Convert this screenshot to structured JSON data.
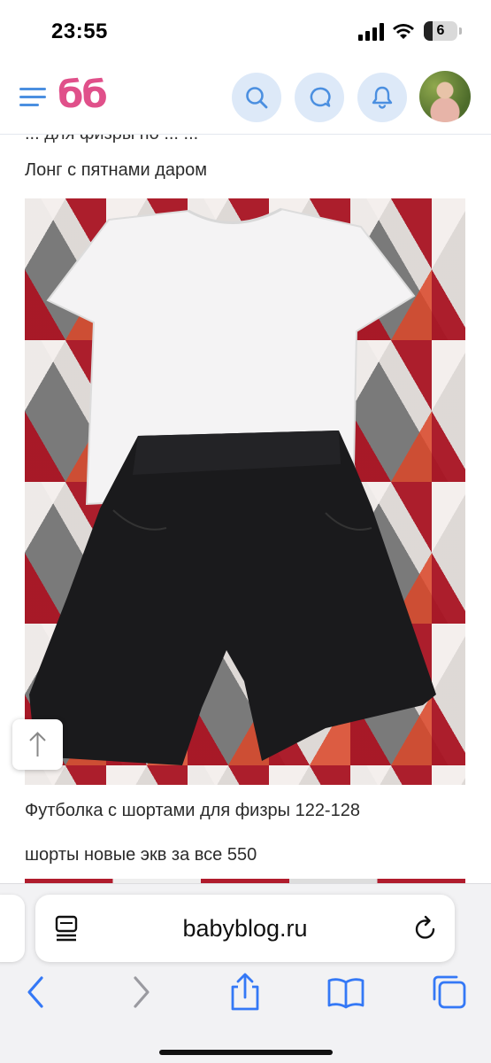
{
  "status_bar": {
    "time": "23:55",
    "battery_level": "6"
  },
  "header": {
    "logo": "бб",
    "icons": [
      "menu-icon",
      "search-icon",
      "chat-icon",
      "bell-icon"
    ]
  },
  "post": {
    "cut_off_line": "... для физры по ... ...",
    "caption_1": "Лонг с пятнами даром",
    "caption_2": "Футболка с шортами для физры 122-128",
    "caption_3": "шорты новые экв за все 550"
  },
  "browser": {
    "url": "babyblog.ru",
    "toolbar_icons": [
      "back-icon",
      "forward-icon",
      "share-icon",
      "bookmarks-icon",
      "tabs-icon"
    ]
  },
  "colors": {
    "accent": "#4b8fe0",
    "logo": "#e0508a",
    "header_button_bg": "#dde9f8"
  }
}
